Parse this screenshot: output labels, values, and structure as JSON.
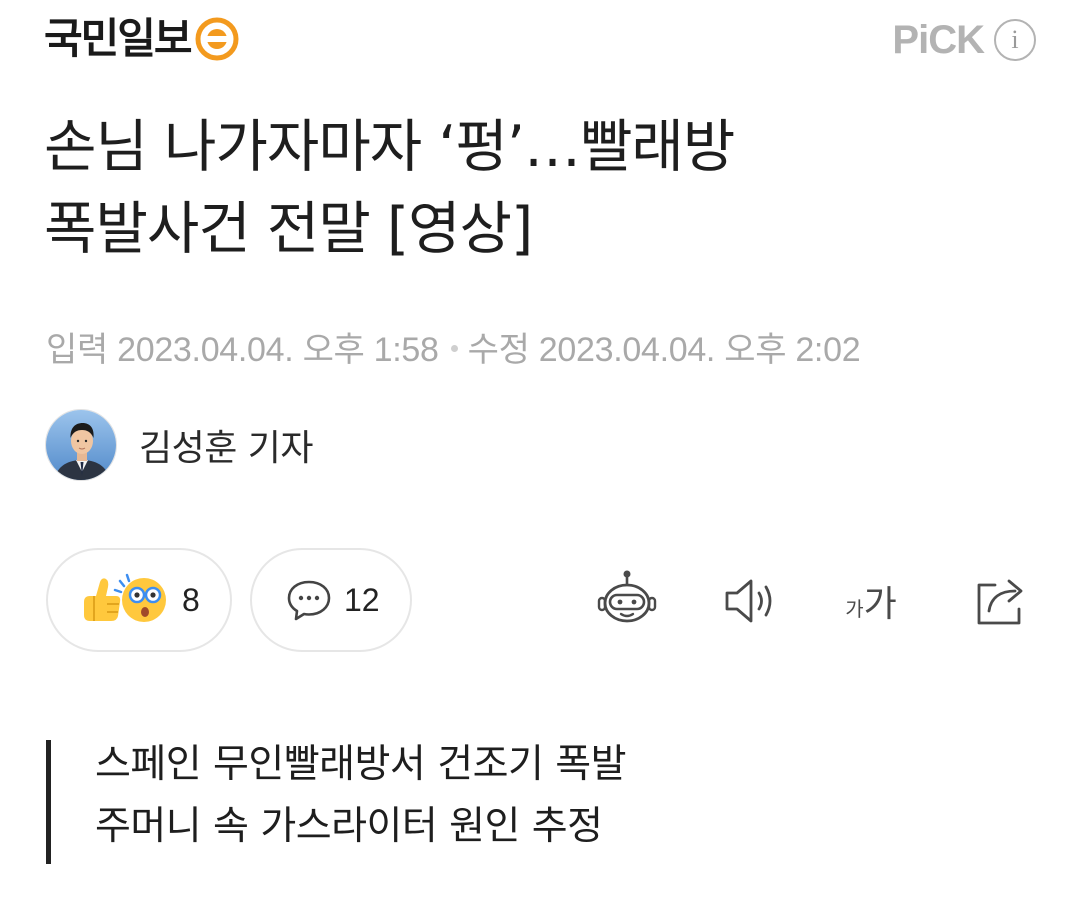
{
  "header": {
    "logo_text": "국민일보",
    "pick_label": "PiCK",
    "info_symbol": "i"
  },
  "article": {
    "title_line1": "손님 나가자마자 ‘펑’…빨래방",
    "title_line2": "폭발사건 전말 [영상]",
    "input_date": "입력 2023.04.04. 오후 1:58",
    "edit_date": "수정 2023.04.04. 오후 2:02",
    "author": "김성훈 기자"
  },
  "actions": {
    "reaction_count": "8",
    "comment_count": "12",
    "font_small": "가",
    "font_big": "가"
  },
  "summary": {
    "line1": "스페인 무인빨래방서 건조기 폭발",
    "line2": "주머니 속 가스라이터 원인 추정"
  },
  "icons": {
    "logo_mark": "orange-circle-logo-icon",
    "reaction": "thumbs-up-and-surprised-emoji-icon",
    "comment": "speech-bubble-icon",
    "ai_summary": "robot-icon",
    "tts": "speaker-icon",
    "font_size": "font-size-icon",
    "share": "share-icon"
  },
  "colors": {
    "logo_orange": "#F39A1E",
    "emoji_yellow": "#FFC83D",
    "emoji_blue": "#3D8EF0",
    "muted_text": "#A9A9A9"
  }
}
